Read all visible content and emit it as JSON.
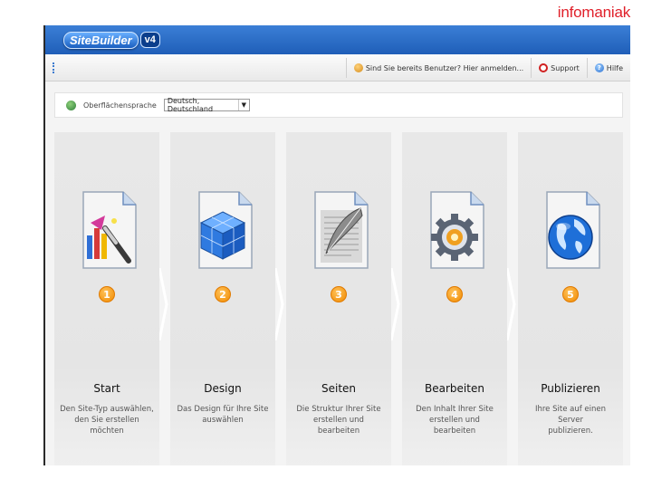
{
  "brand": "infomaniak",
  "logo": {
    "text": "SiteBuilder",
    "version": "v4"
  },
  "toolbar": {
    "login_prompt": "Sind Sie bereits Benutzer? Hier anmelden...",
    "support_label": "Support",
    "help_label": "Hilfe"
  },
  "language": {
    "label": "Oberflächensprache",
    "selected": "Deutsch, Deutschland"
  },
  "steps": [
    {
      "number": "1",
      "title": "Start",
      "desc_line1": "Den Site-Typ auswählen,",
      "desc_line2": "den Sie erstellen möchten",
      "icon": "wizard-tools-icon"
    },
    {
      "number": "2",
      "title": "Design",
      "desc_line1": "Das Design für Ihre Site",
      "desc_line2": "auswählen",
      "icon": "cube-design-icon"
    },
    {
      "number": "3",
      "title": "Seiten",
      "desc_line1": "Die Struktur Ihrer Site",
      "desc_line2": "erstellen und bearbeiten",
      "icon": "quill-document-icon"
    },
    {
      "number": "4",
      "title": "Bearbeiten",
      "desc_line1": "Den Inhalt Ihrer Site",
      "desc_line2": "erstellen und bearbeiten",
      "icon": "gear-edit-icon"
    },
    {
      "number": "5",
      "title": "Publizieren",
      "desc_line1": "Ihre Site auf einen Server",
      "desc_line2": "publizieren.",
      "icon": "globe-publish-icon"
    }
  ],
  "colors": {
    "header": "#1f5eb8",
    "accent": "#f08a00",
    "brand": "#e0202a"
  }
}
